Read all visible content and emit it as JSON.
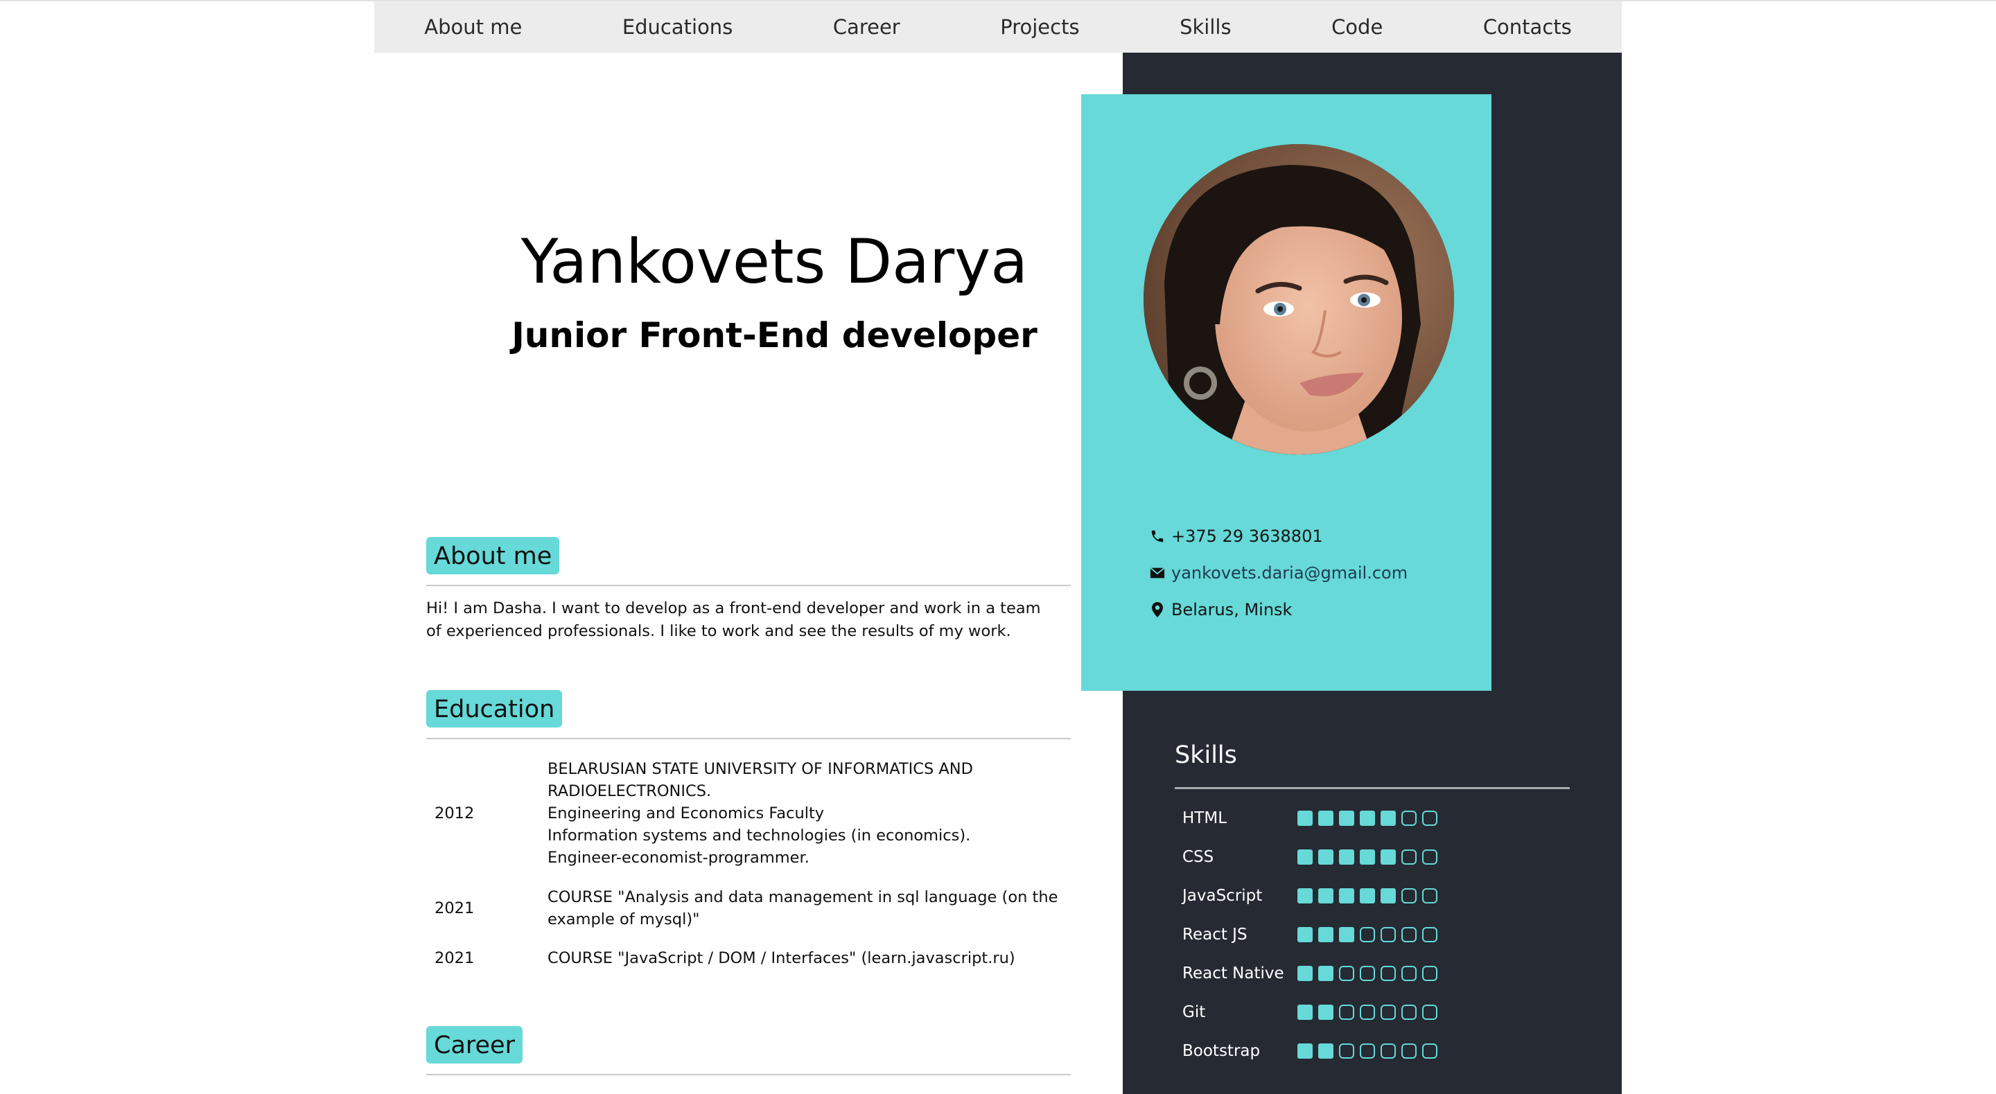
{
  "nav": {
    "items": [
      {
        "label": "About me"
      },
      {
        "label": "Educations"
      },
      {
        "label": "Career"
      },
      {
        "label": "Projects"
      },
      {
        "label": "Skills"
      },
      {
        "label": "Code"
      },
      {
        "label": "Contacts"
      }
    ]
  },
  "hero": {
    "name": "Yankovets Darya",
    "role": "Junior Front-End developer"
  },
  "contacts": {
    "phone": "+375 29 3638801",
    "email": "yankovets.daria@gmail.com",
    "location": "Belarus, Minsk",
    "icons": [
      "phone-icon",
      "envelope-icon",
      "location-pin-icon"
    ]
  },
  "about": {
    "title": "About me",
    "text": "Hi! I am Dasha. I want to develop as a front-end developer and work in a team of experienced professionals. I like to work and see the results of my work."
  },
  "education": {
    "title": "Education",
    "items": [
      {
        "year": "2012",
        "lines": [
          "BELARUSIAN STATE UNIVERSITY OF INFORMATICS AND",
          "RADIOELECTRONICS.",
          "Engineering and Economics Faculty",
          "Information systems and technologies (in economics).",
          "Engineer-economist-programmer."
        ]
      },
      {
        "year": "2021",
        "lines": [
          "COURSE \"Analysis and data management in sql language (on the",
          "example of mysql)\""
        ]
      },
      {
        "year": "2021",
        "lines": [
          "COURSE \"JavaScript / DOM / Interfaces\" (learn.javascript.ru)"
        ]
      }
    ]
  },
  "career": {
    "title": "Career"
  },
  "skills": {
    "title": "Skills",
    "max_level": 7,
    "items": [
      {
        "name": "HTML",
        "level": 5
      },
      {
        "name": "CSS",
        "level": 5
      },
      {
        "name": "JavaScript",
        "level": 5
      },
      {
        "name": "React JS",
        "level": 3
      },
      {
        "name": "React Native",
        "level": 2
      },
      {
        "name": "Git",
        "level": 2
      },
      {
        "name": "Bootstrap",
        "level": 2
      }
    ]
  },
  "colors": {
    "accent": "#66d9d8",
    "dark": "#252a33",
    "nav_bg": "#ececec"
  }
}
